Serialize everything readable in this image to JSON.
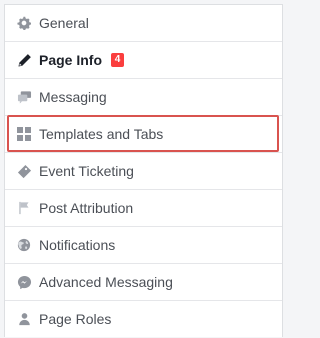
{
  "menu": {
    "items": [
      {
        "label": "General",
        "icon": "gear-icon"
      },
      {
        "label": "Page Info",
        "icon": "pencil-icon",
        "badge": "4",
        "active": true
      },
      {
        "label": "Messaging",
        "icon": "chat-bubbles-icon"
      },
      {
        "label": "Templates and Tabs",
        "icon": "grid-icon",
        "highlighted": true
      },
      {
        "label": "Event Ticketing",
        "icon": "ticket-icon"
      },
      {
        "label": "Post Attribution",
        "icon": "flag-icon"
      },
      {
        "label": "Notifications",
        "icon": "globe-icon"
      },
      {
        "label": "Advanced Messaging",
        "icon": "messenger-icon"
      },
      {
        "label": "Page Roles",
        "icon": "person-icon"
      }
    ]
  },
  "colors": {
    "highlight_border": "#d9534f",
    "badge_bg": "#fa3e3e",
    "icon_gray": "#90949c",
    "active_icon": "#1d2129"
  }
}
